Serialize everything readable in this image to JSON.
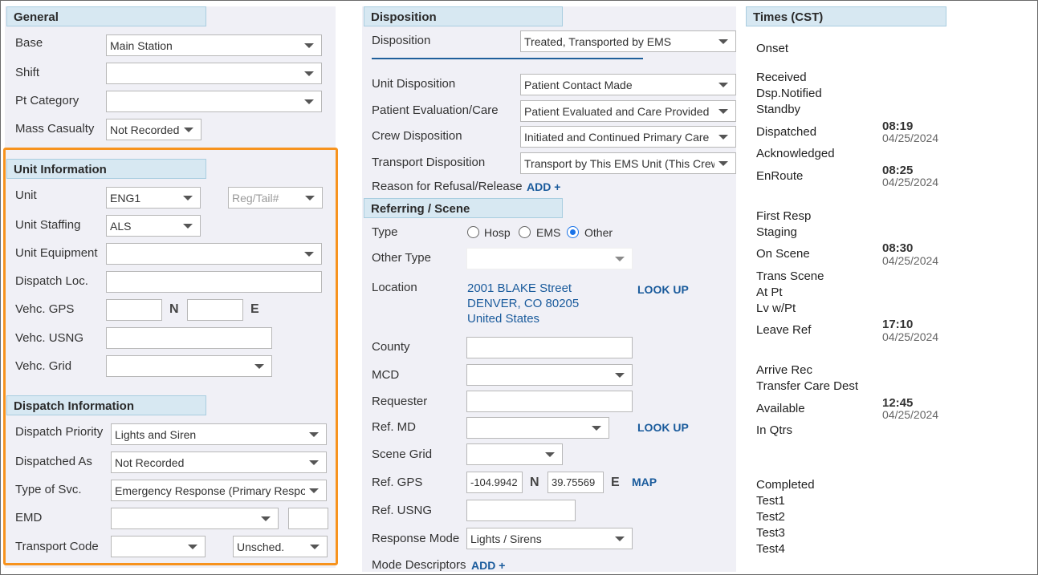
{
  "general": {
    "title": "General",
    "base": {
      "label": "Base",
      "value": "Main Station"
    },
    "shift": {
      "label": "Shift",
      "value": ""
    },
    "pt_category": {
      "label": "Pt Category",
      "value": ""
    },
    "mass_casualty": {
      "label": "Mass Casualty",
      "value": "Not Recorded"
    }
  },
  "unit_info": {
    "title": "Unit Information",
    "unit": {
      "label": "Unit",
      "value": "ENG1",
      "reg_placeholder": "Reg/Tail#"
    },
    "staffing": {
      "label": "Unit Staffing",
      "value": "ALS"
    },
    "equipment": {
      "label": "Unit Equipment",
      "value": ""
    },
    "dispatch_loc": {
      "label": "Dispatch Loc.",
      "value": ""
    },
    "gps": {
      "label": "Vehc. GPS",
      "n": "N",
      "e": "E",
      "lat": "",
      "lon": ""
    },
    "usng": {
      "label": "Vehc. USNG",
      "value": ""
    },
    "grid": {
      "label": "Vehc. Grid",
      "value": ""
    }
  },
  "dispatch_info": {
    "title": "Dispatch Information",
    "priority": {
      "label": "Dispatch Priority",
      "value": "Lights and Siren"
    },
    "dispatched_as": {
      "label": "Dispatched As",
      "value": "Not Recorded"
    },
    "type_svc": {
      "label": "Type of Svc.",
      "value": "Emergency Response (Primary Response Area)"
    },
    "emd": {
      "label": "EMD",
      "value": "",
      "code": ""
    },
    "transport_code": {
      "label": "Transport Code",
      "value": "",
      "sched": "Unsched."
    }
  },
  "disposition": {
    "title": "Disposition",
    "disposition": {
      "label": "Disposition",
      "value": "Treated, Transported by EMS"
    },
    "unit_disp": {
      "label": "Unit Disposition",
      "value": "Patient Contact Made"
    },
    "pt_eval": {
      "label": "Patient Evaluation/Care",
      "value": "Patient Evaluated and Care Provided"
    },
    "crew_disp": {
      "label": "Crew Disposition",
      "value": "Initiated and Continued Primary Care"
    },
    "transport_disp": {
      "label": "Transport Disposition",
      "value": "Transport by This EMS Unit (This Crew Only)"
    },
    "refusal": {
      "label": "Reason for Refusal/Release",
      "add": "ADD +"
    }
  },
  "referring": {
    "title": "Referring / Scene",
    "type": {
      "label": "Type",
      "options": [
        "Hosp",
        "EMS",
        "Other"
      ],
      "selected": "Other"
    },
    "other_type": {
      "label": "Other Type",
      "value": ""
    },
    "location": {
      "label": "Location",
      "line1": "2001 BLAKE Street",
      "line2": "DENVER, CO 80205",
      "line3": "United States",
      "lookup": "LOOK UP"
    },
    "county": {
      "label": "County",
      "value": ""
    },
    "mcd": {
      "label": "MCD",
      "value": ""
    },
    "requester": {
      "label": "Requester",
      "value": ""
    },
    "ref_md": {
      "label": "Ref. MD",
      "value": "",
      "lookup": "LOOK UP"
    },
    "scene_grid": {
      "label": "Scene Grid",
      "value": ""
    },
    "ref_gps": {
      "label": "Ref. GPS",
      "lat": "-104.9942",
      "n": "N",
      "lon": "39.75569",
      "e": "E",
      "map": "MAP"
    },
    "ref_usng": {
      "label": "Ref. USNG",
      "value": ""
    },
    "response_mode": {
      "label": "Response Mode",
      "value": "Lights / Sirens"
    },
    "mode_desc": {
      "label": "Mode Descriptors",
      "add": "ADD +"
    }
  },
  "times": {
    "title": "Times (CST)",
    "onset": "Onset",
    "received": "Received",
    "dsp_notified": "Dsp.Notified",
    "standby": "Standby",
    "dispatched": {
      "label": "Dispatched",
      "time": "08:19",
      "date": "04/25/2024"
    },
    "acknowledged": "Acknowledged",
    "enroute": {
      "label": "EnRoute",
      "time": "08:25",
      "date": "04/25/2024"
    },
    "first_resp": "First Resp",
    "staging": "Staging",
    "on_scene": {
      "label": "On Scene",
      "time": "08:30",
      "date": "04/25/2024"
    },
    "trans_scene": "Trans Scene",
    "at_pt": "At Pt",
    "lv_wpt": "Lv w/Pt",
    "leave_ref": {
      "label": "Leave Ref",
      "time": "17:10",
      "date": "04/25/2024"
    },
    "arrive_rec": "Arrive Rec",
    "transfer_care": "Transfer Care Dest",
    "available": {
      "label": "Available",
      "time": "12:45",
      "date": "04/25/2024"
    },
    "in_qtrs": "In Qtrs",
    "completed": "Completed",
    "test1": "Test1",
    "test2": "Test2",
    "test3": "Test3",
    "test4": "Test4"
  },
  "colors": {
    "accent": "#1a5b9c",
    "highlight": "#f7931e",
    "header_bg": "#d7e8f2",
    "panel_bg": "#f0f0f6"
  }
}
